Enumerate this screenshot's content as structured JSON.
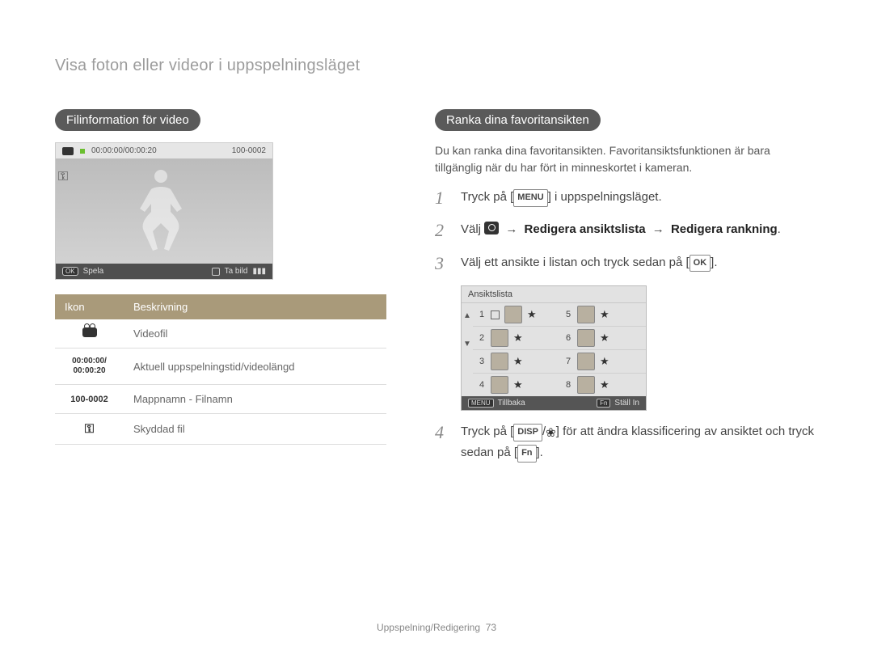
{
  "page_title": "Visa foton eller videor i uppspelningsläget",
  "left": {
    "section_label": "Filinformation för video",
    "video_card": {
      "time": "00:00:00/00:00:20",
      "fileno": "100-0002",
      "foot_left_badge": "OK",
      "foot_left_label": "Spela",
      "foot_right_label": "Ta bild"
    },
    "table_head_icon": "Ikon",
    "table_head_desc": "Beskrivning",
    "rows": [
      {
        "icon_type": "cam",
        "icon_text": "",
        "desc": "Videofil"
      },
      {
        "icon_type": "text",
        "icon_text": "00:00:00/\n00:00:20",
        "desc": "Aktuell uppspelningstid/videolängd"
      },
      {
        "icon_type": "text",
        "icon_text": "100-0002",
        "desc": "Mappnamn - Filnamn"
      },
      {
        "icon_type": "key",
        "icon_text": "⚿",
        "desc": "Skyddad fil"
      }
    ]
  },
  "right": {
    "section_label": "Ranka dina favoritansikten",
    "intro": "Du kan ranka dina favoritansikten. Favoritansiktsfunktionen är bara tillgänglig när du har fört in minneskortet i kameran.",
    "step1_a": "Tryck på [",
    "step1_btn": "MENU",
    "step1_b": "] i uppspelningsläget.",
    "step2_a": "Välj ",
    "step2_path_a": "Redigera ansiktslista",
    "step2_path_b": "Redigera rankning",
    "step3_a": "Välj ett ansikte i listan och tryck sedan på [",
    "step3_btn": "OK",
    "step3_b": "].",
    "facecard": {
      "title": "Ansiktslista",
      "left_nums": [
        "1",
        "2",
        "3",
        "4"
      ],
      "right_nums": [
        "5",
        "6",
        "7",
        "8"
      ],
      "foot_left_tag": "MENU",
      "foot_left_label": "Tillbaka",
      "foot_right_tag": "Fn",
      "foot_right_label": "Ställ In"
    },
    "step4_a": "Tryck på [",
    "step4_btn": "DISP",
    "step4_b": "] för att ändra klassificering av ansiktet och tryck sedan på [",
    "step4_btn2": "Fn",
    "step4_c": "]."
  },
  "footer_label": "Uppspelning/Redigering",
  "footer_page": "73"
}
